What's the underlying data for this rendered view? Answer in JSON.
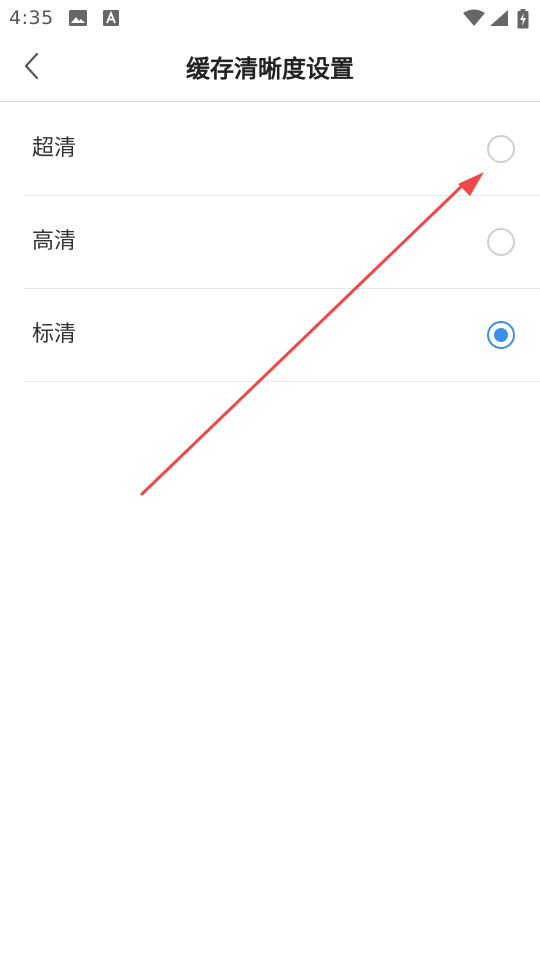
{
  "status_bar": {
    "time": "4:35",
    "icons": [
      "image-icon",
      "text-a-icon",
      "wifi-icon",
      "signal-icon",
      "battery-charging-icon"
    ]
  },
  "header": {
    "back_icon": "chevron-left-icon",
    "title": "缓存清晰度设置"
  },
  "options": [
    {
      "label": "超清",
      "selected": false
    },
    {
      "label": "高清",
      "selected": false
    },
    {
      "label": "标清",
      "selected": true
    }
  ],
  "colors": {
    "accent": "#3f8ee8",
    "annotation_arrow": "#f04848"
  }
}
